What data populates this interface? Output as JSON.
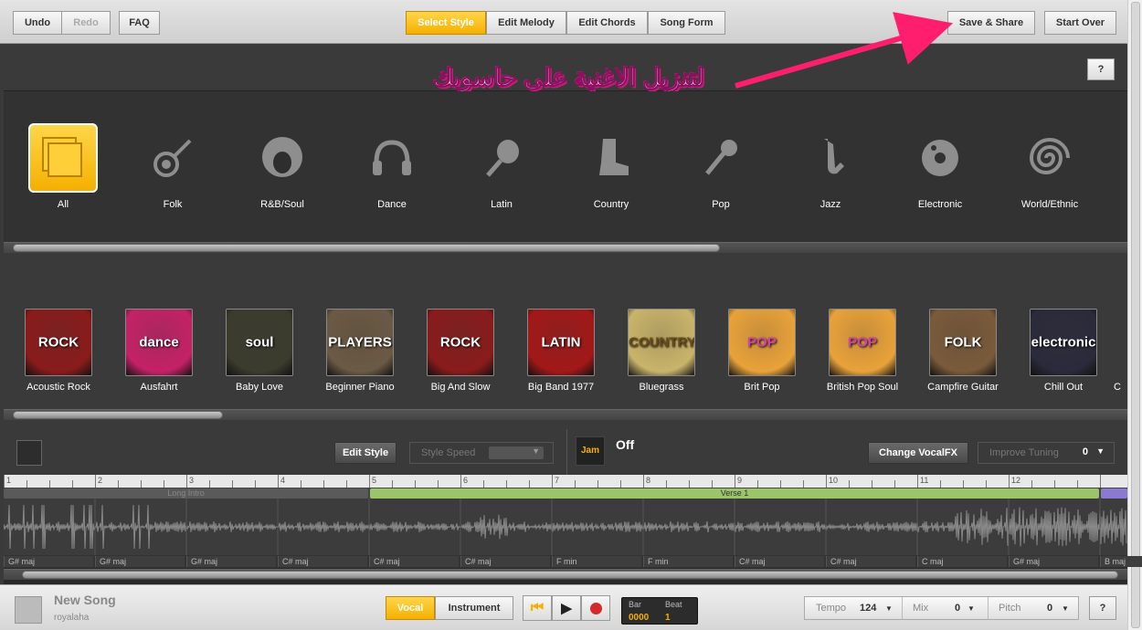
{
  "toolbar": {
    "undo": "Undo",
    "redo": "Redo",
    "faq": "FAQ",
    "tabs": [
      "Select Style",
      "Edit Melody",
      "Edit Chords",
      "Song Form"
    ],
    "save_share": "Save & Share",
    "start_over": "Start Over"
  },
  "annotation": {
    "text": "لتنزيل الاغنية على حاسوبك"
  },
  "help_label": "?",
  "genres": [
    "All",
    "Folk",
    "R&B/Soul",
    "Dance",
    "Latin",
    "Country",
    "Pop",
    "Jazz",
    "Electronic",
    "World/Ethnic"
  ],
  "genre_icons": [
    "all-icon",
    "banjo-icon",
    "afro-icon",
    "headphones-icon",
    "maracas-icon",
    "cowboy-boot-icon",
    "microphone-icon",
    "saxophone-icon",
    "vinyl-icon",
    "spiral-icon"
  ],
  "styles": [
    {
      "label": "Acoustic Rock",
      "art": "ROCK",
      "color": "#8a1b1b"
    },
    {
      "label": "Ausfahrt",
      "art": "dance",
      "color": "#c42266"
    },
    {
      "label": "Baby Love",
      "art": "soul",
      "color": "#3b3b2e"
    },
    {
      "label": "Beginner Piano",
      "art": "PLAYERS",
      "color": "#6b5a44"
    },
    {
      "label": "Big And Slow",
      "art": "ROCK",
      "color": "#8a1b1b"
    },
    {
      "label": "Big Band 1977",
      "art": "LATIN",
      "color": "#a31818"
    },
    {
      "label": "Bluegrass",
      "art": "COUNTRY",
      "color": "#c9b46a"
    },
    {
      "label": "Brit Pop",
      "art": "POP",
      "color": "#e9a23a"
    },
    {
      "label": "British Pop Soul",
      "art": "POP",
      "color": "#e9a23a"
    },
    {
      "label": "Campfire Guitar",
      "art": "FOLK",
      "color": "#7a5a3a"
    },
    {
      "label": "Chill Out",
      "art": "electronic",
      "color": "#2a2a3a"
    },
    {
      "label": "C",
      "art": "",
      "color": "#333"
    }
  ],
  "controls": {
    "edit_style": "Edit Style",
    "style_speed": "Style Speed",
    "vocalfx_state": "Off",
    "change_vocalfx": "Change VocalFX",
    "improve_tuning": "Improve Tuning",
    "improve_value": "0",
    "logo_text": "Jam"
  },
  "timeline": {
    "bars": [
      "1",
      "2",
      "3",
      "4",
      "5",
      "6",
      "7",
      "8",
      "9",
      "10",
      "11",
      "12"
    ],
    "sections": [
      {
        "label": "Long Intro",
        "color": "#555"
      },
      {
        "label": "Verse 1",
        "color": "#9cc46a"
      }
    ],
    "chords": [
      "G# maj",
      "G# maj",
      "G# maj",
      "C# maj",
      "C# maj",
      "C# maj",
      "F min",
      "F min",
      "C# maj",
      "C# maj",
      "C maj",
      "G# maj",
      "B maj"
    ]
  },
  "song": {
    "title": "New Song",
    "artist": "royalaha"
  },
  "transport": {
    "vocal": "Vocal",
    "instrument": "Instrument",
    "bar_label": "Bar",
    "beat_label": "Beat",
    "bar_value": "0000",
    "beat_value": "1"
  },
  "settings": {
    "tempo_label": "Tempo",
    "tempo_value": "124",
    "mix_label": "Mix",
    "mix_value": "0",
    "pitch_label": "Pitch",
    "pitch_value": "0",
    "help": "?"
  }
}
